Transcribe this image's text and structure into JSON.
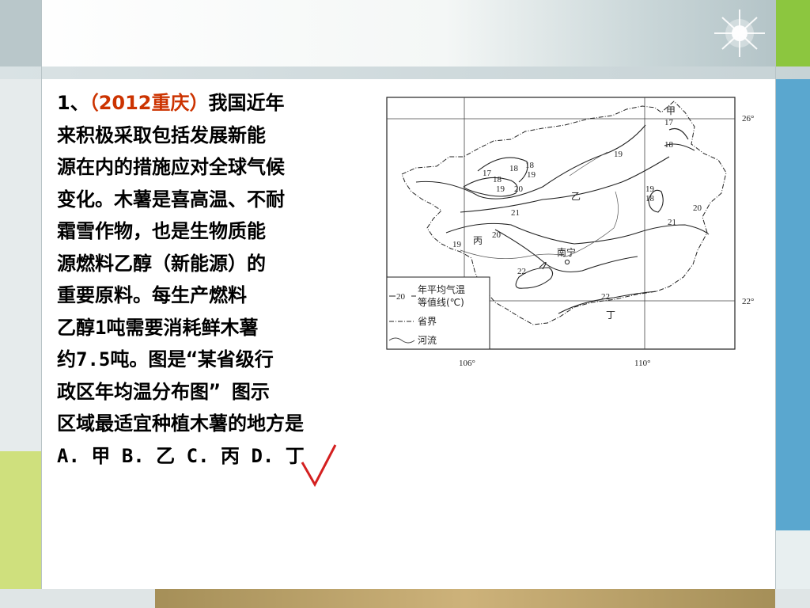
{
  "question": {
    "number": "1、",
    "source": "（2012重庆）",
    "lines": [
      "我国近年",
      "来积极采取包括发展新能",
      "源在内的措施应对全球气候",
      "变化。木薯是喜高温、不耐",
      "霜雪作物，也是生物质能",
      "源燃料乙醇（新能源）的",
      "重要原料。每生产燃料",
      "乙醇1吨需要消耗鲜木薯",
      "约7.5吨。图是“某省级行",
      "政区年均温分布图” 图示",
      "区域最适宜种植木薯的地方是"
    ],
    "options": [
      "A. 甲",
      "B. 乙",
      " C. 丙",
      "D. 丁"
    ]
  },
  "map": {
    "latitudes": [
      "26°",
      "22°"
    ],
    "longitudes": [
      "106°",
      "110°"
    ],
    "regions": [
      "甲",
      "乙",
      "丙",
      "丁"
    ],
    "city": "南宁",
    "isotherms": [
      "17",
      "18",
      "19",
      "20",
      "21",
      "22"
    ],
    "legend": {
      "sample_value": "20",
      "isotherm_line": "年平均气温等值线(℃)",
      "isotherm_line_1": "年平均气温",
      "isotherm_line_2": "等值线(℃)",
      "boundary": "省界",
      "river": "河流"
    }
  },
  "answer_mark": "check-mark",
  "colors": {
    "source_tag": "#cc3300",
    "check_mark": "#d42020",
    "gold_band": "#b89c63"
  }
}
